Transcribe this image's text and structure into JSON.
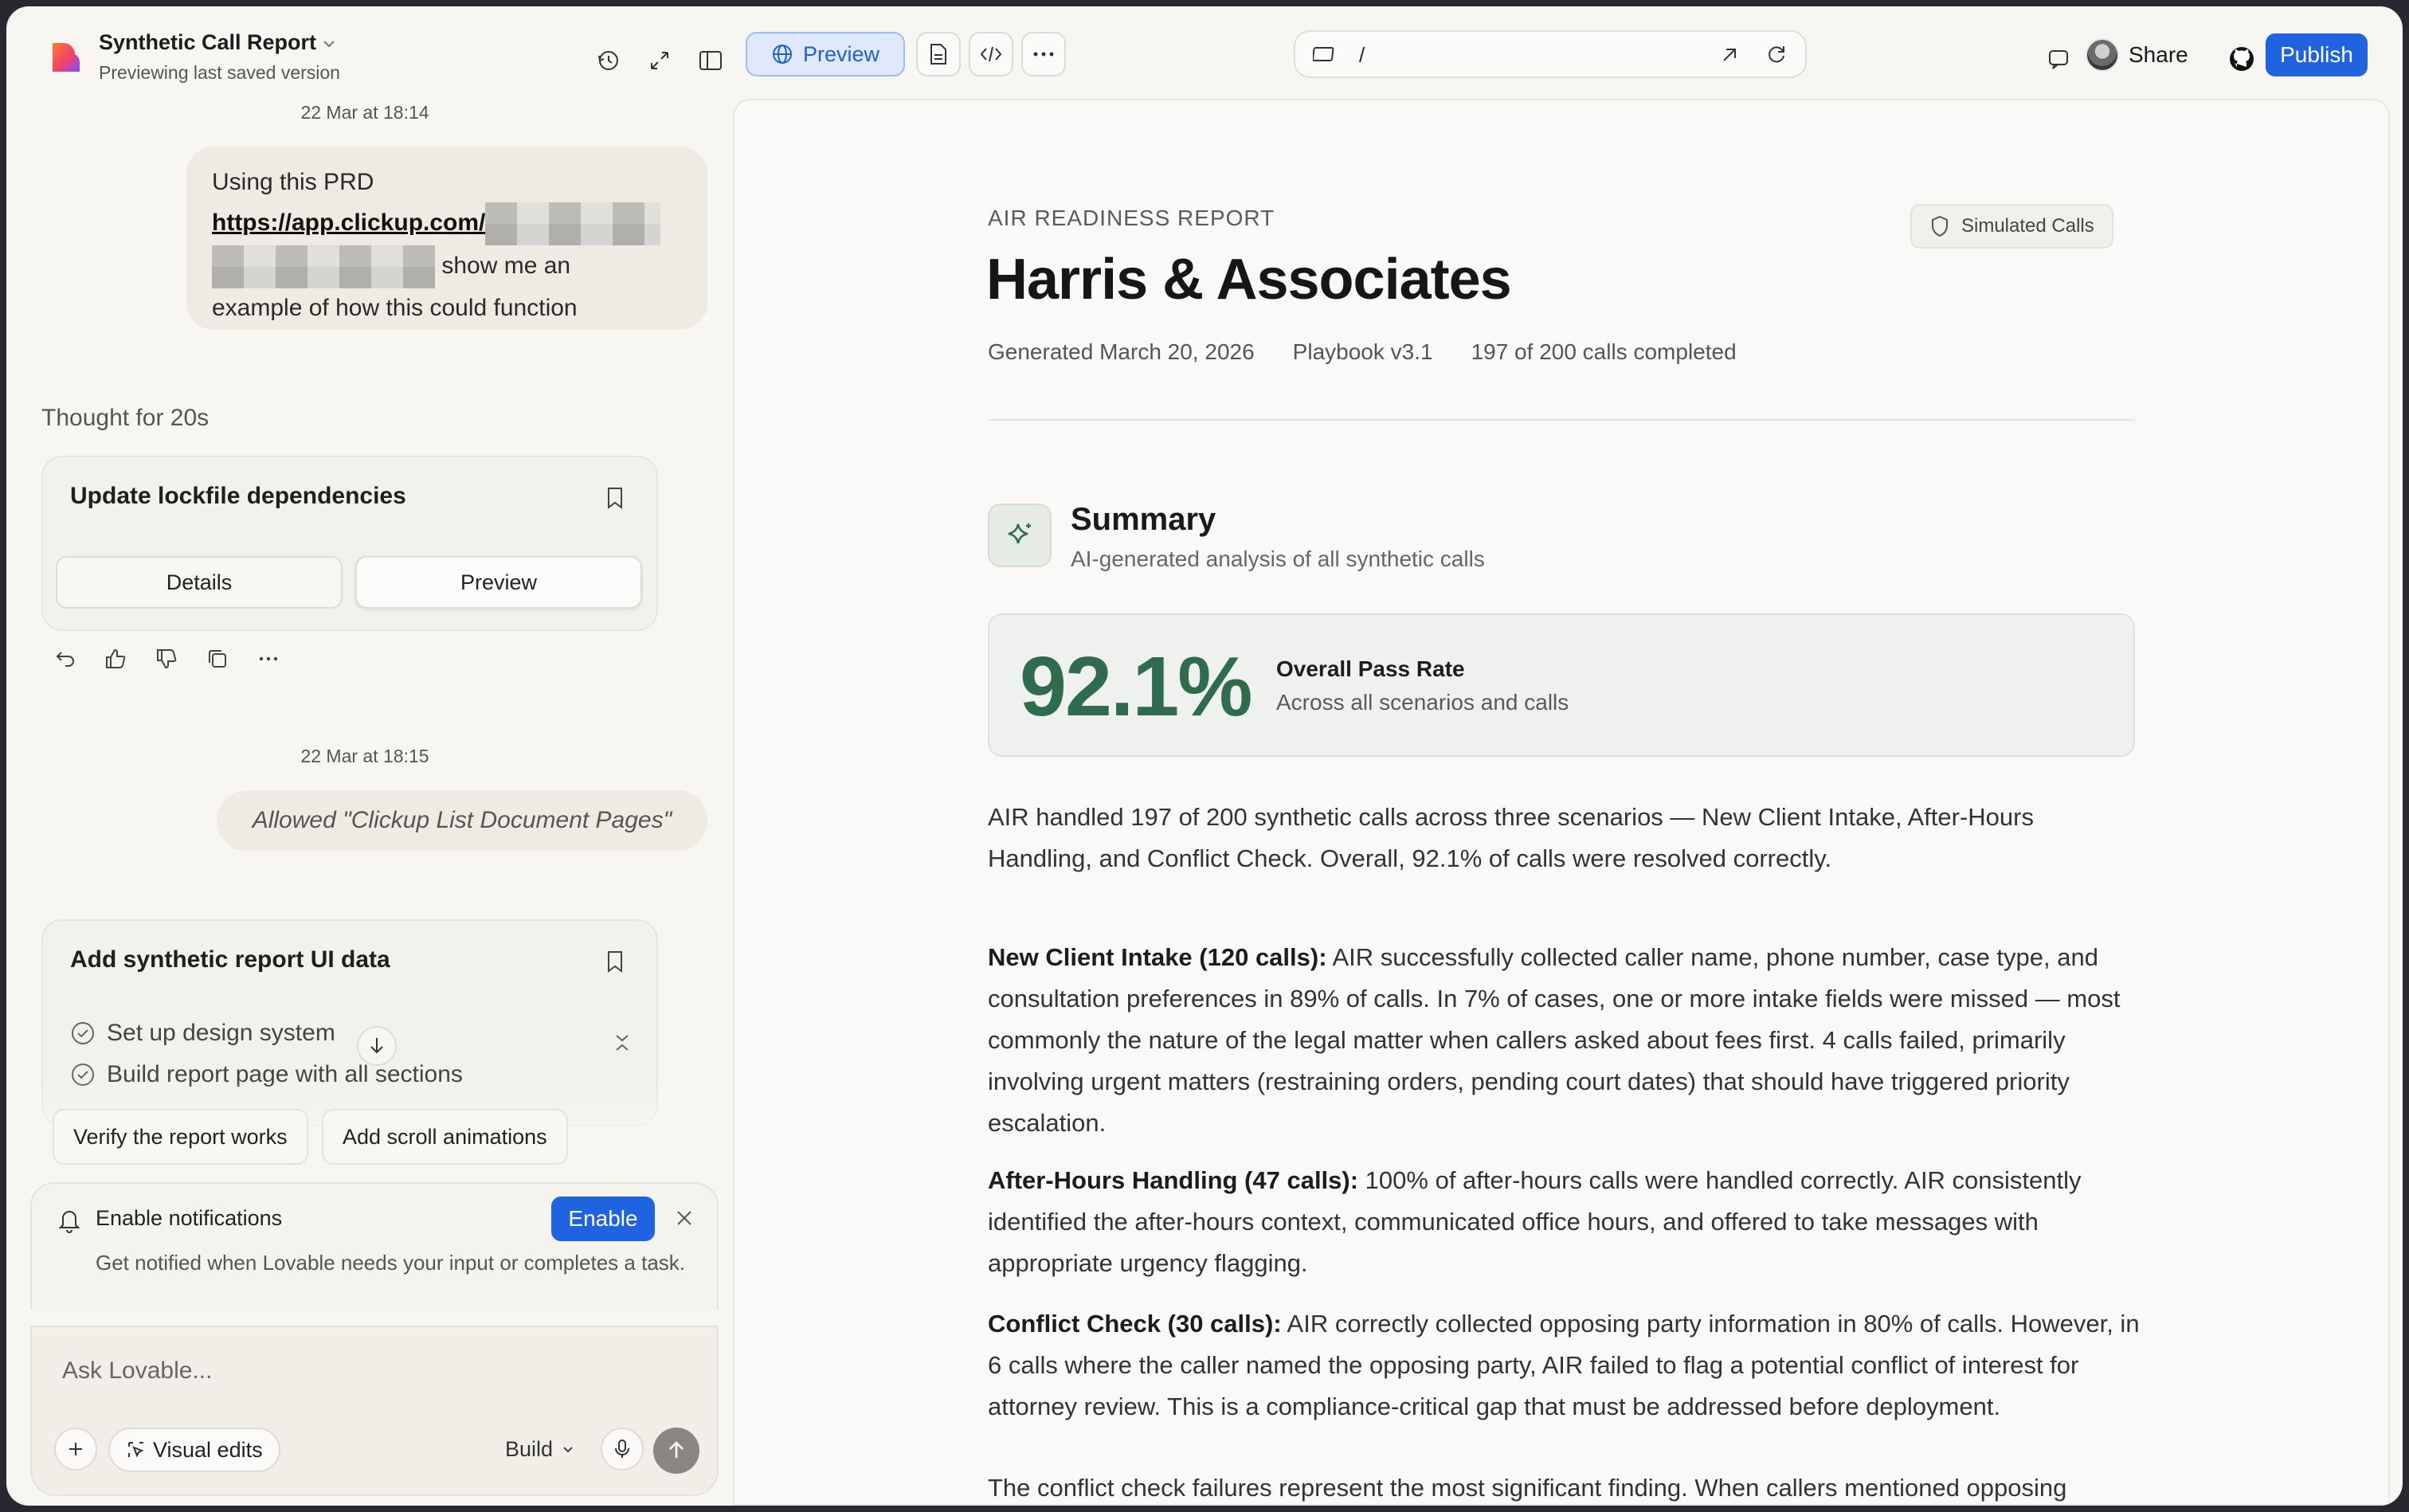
{
  "project": {
    "title": "Synthetic Call Report",
    "subtitle": "Previewing last saved version"
  },
  "toolbar": {
    "preview_label": "Preview",
    "url_path": "/",
    "share_label": "Share",
    "publish_label": "Publish"
  },
  "chat": {
    "timestamp_1": "22 Mar at 18:14",
    "user_message": {
      "line1": "Using this PRD",
      "link": "https://app.clickup.com/",
      "line3": "show me an",
      "line4": "example of how this could function"
    },
    "thought": "Thought for 20s",
    "task1": {
      "title": "Update lockfile dependencies",
      "details_label": "Details",
      "preview_label": "Preview"
    },
    "timestamp_2": "22 Mar at 18:15",
    "allowed": "Allowed \"Clickup List Document Pages\"",
    "task2": {
      "title": "Add synthetic report UI data",
      "steps": [
        "Set up design system",
        "Build report page with all sections"
      ]
    },
    "suggestions": [
      "Verify the report works",
      "Add scroll animations"
    ],
    "notification": {
      "title": "Enable notifications",
      "enable_label": "Enable",
      "description": "Get notified when Lovable needs your input or completes a task."
    },
    "input": {
      "placeholder": "Ask Lovable...",
      "visual_edits_label": "Visual edits",
      "mode_label": "Build"
    }
  },
  "report": {
    "eyebrow": "AIR READINESS REPORT",
    "title": "Harris & Associates",
    "badge": "Simulated Calls",
    "meta": [
      "Generated March 20, 2026",
      "Playbook v3.1",
      "197 of 200 calls completed"
    ],
    "summary_title": "Summary",
    "summary_sub": "AI-generated analysis of all synthetic calls",
    "pass_rate": "92.1%",
    "pass_label": "Overall Pass Rate",
    "pass_sub": "Across all scenarios and calls",
    "para1": "AIR handled 197 of 200 synthetic calls across three scenarios — New Client Intake, After-Hours Handling, and Conflict Check. Overall, 92.1% of calls were resolved correctly.",
    "para2_head": "New Client Intake (120 calls):",
    "para2": " AIR successfully collected caller name, phone number, case type, and consultation preferences in 89% of calls. In 7% of cases, one or more intake fields were missed — most commonly the nature of the legal matter when callers asked about fees first. 4 calls failed, primarily involving urgent matters (restraining orders, pending court dates) that should have triggered priority escalation.",
    "para3_head": "After-Hours Handling (47 calls):",
    "para3": " 100% of after-hours calls were handled correctly. AIR consistently identified the after-hours context, communicated office hours, and offered to take messages with appropriate urgency flagging.",
    "para4_head": "Conflict Check (30 calls):",
    "para4": " AIR correctly collected opposing party information in 80% of calls. However, in 6 calls where the caller named the opposing party, AIR failed to flag a potential conflict of interest for attorney review. This is a compliance-critical gap that must be addressed before deployment.",
    "para5": "The conflict check failures represent the most significant finding. When callers mentioned opposing"
  }
}
